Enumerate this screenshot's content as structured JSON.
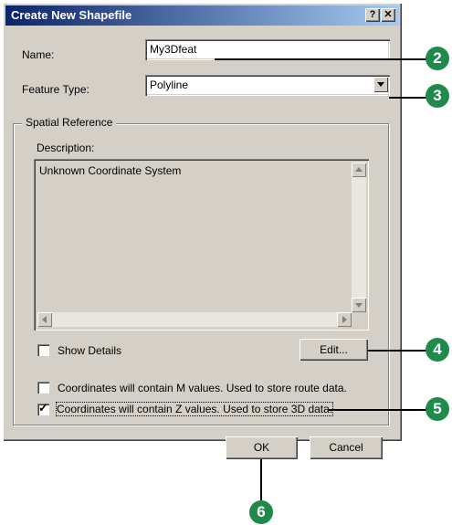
{
  "dialog": {
    "title": "Create New Shapefile",
    "help_button": "?",
    "close_button": "✕"
  },
  "form": {
    "name_label": "Name:",
    "name_value": "My3Dfeat",
    "feature_type_label": "Feature Type:",
    "feature_type_value": "Polyline"
  },
  "spatial_reference": {
    "legend": "Spatial Reference",
    "description_label": "Description:",
    "description_text": "Unknown Coordinate System",
    "show_details_label": "Show Details",
    "show_details_checked": false,
    "edit_button": "Edit..."
  },
  "options": {
    "m_values_label": "Coordinates will contain M values. Used to store route data.",
    "m_values_checked": false,
    "z_values_label": "Coordinates will contain Z values. Used to store 3D data.",
    "z_values_checked": true
  },
  "buttons": {
    "ok": "OK",
    "cancel": "Cancel"
  },
  "callouts": {
    "c2": "2",
    "c3": "3",
    "c4": "4",
    "c5": "5",
    "c6": "6",
    "color": "#1f8a4c"
  }
}
